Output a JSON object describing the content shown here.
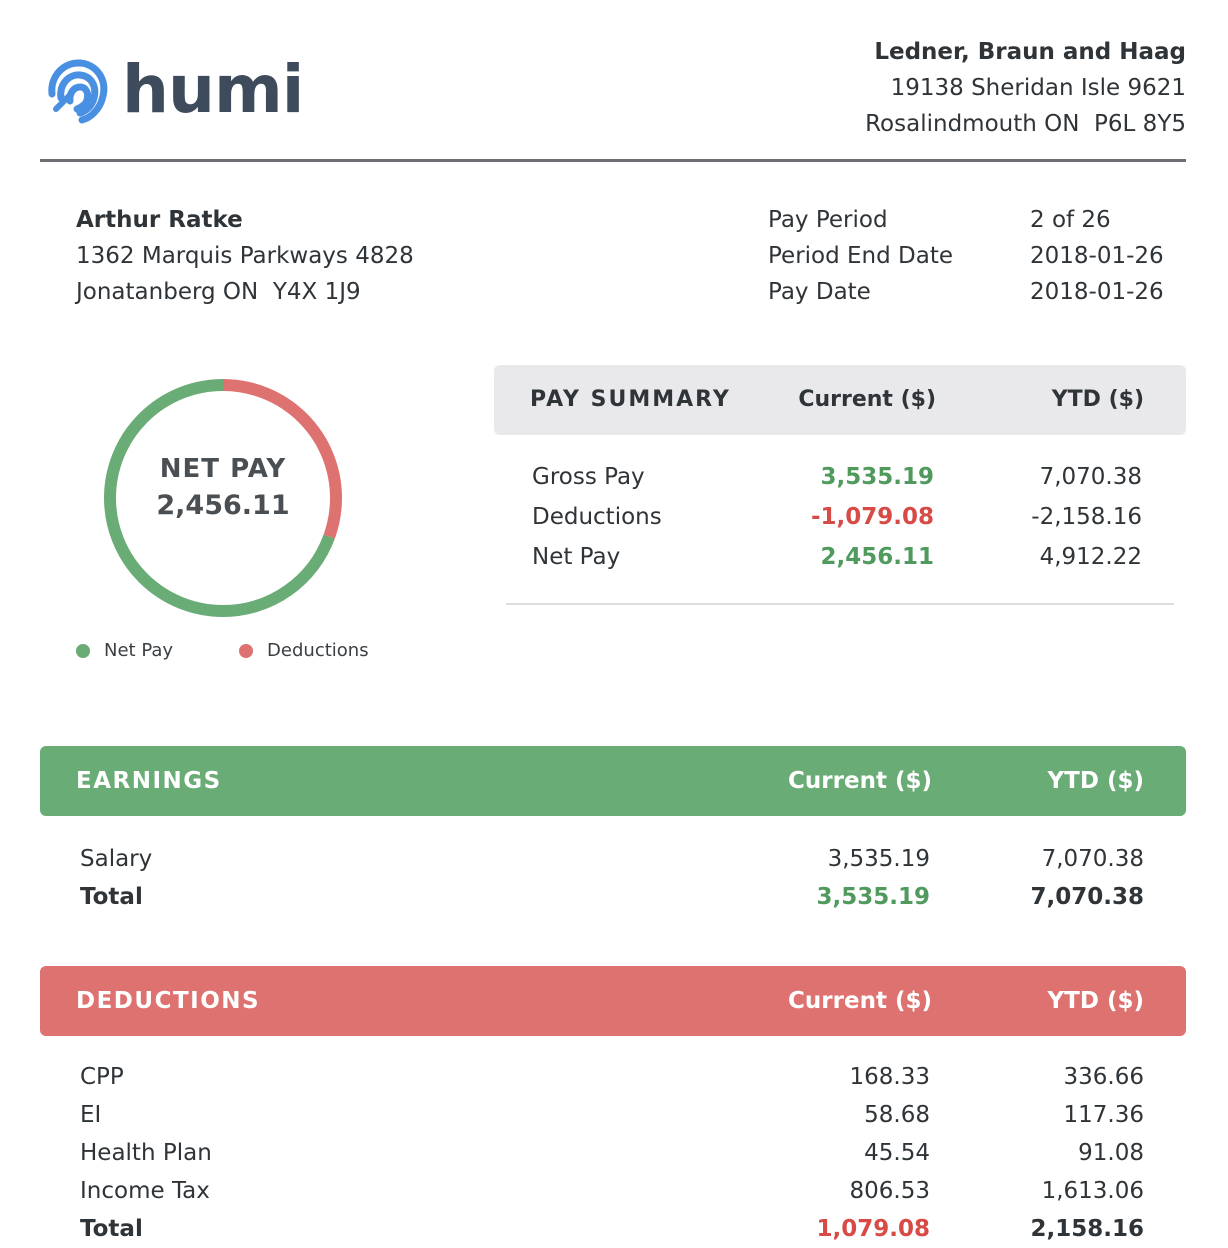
{
  "brand": {
    "name": "humi",
    "color": "#4a90e2"
  },
  "company": {
    "name": "Ledner, Braun and Haag",
    "address1": "19138 Sheridan Isle 9621",
    "address2": "Rosalindmouth ON  P6L 8Y5"
  },
  "employee": {
    "name": "Arthur Ratke",
    "address1": "1362 Marquis Parkways 4828",
    "address2": "Jonatanberg ON  Y4X 1J9"
  },
  "period": {
    "labels": [
      "Pay Period",
      "Period End Date",
      "Pay Date"
    ],
    "values": [
      "2 of 26",
      "2018-01-26",
      "2018-01-26"
    ]
  },
  "donut": {
    "label": "NET PAY",
    "value": "2,456.11",
    "net_pay_amount": 2456.11,
    "deductions_amount": 1079.08,
    "colors": {
      "net_pay": "#6aac76",
      "deductions": "#de7270"
    },
    "legend": [
      "Net Pay",
      "Deductions"
    ]
  },
  "summary": {
    "headers": [
      "PAY SUMMARY",
      "Current ($)",
      "YTD ($)"
    ],
    "rows": [
      {
        "label": "Gross Pay",
        "current": "3,535.19",
        "ytd": "7,070.38"
      },
      {
        "label": "Deductions",
        "current": "-1,079.08",
        "ytd": "-2,158.16"
      },
      {
        "label": "Net Pay",
        "current": "2,456.11",
        "ytd": "4,912.22"
      }
    ]
  },
  "earnings": {
    "headers": [
      "EARNINGS",
      "Current ($)",
      "YTD ($)"
    ],
    "rows": [
      {
        "label": "Salary",
        "current": "3,535.19",
        "ytd": "7,070.38"
      }
    ],
    "total": {
      "label": "Total",
      "current": "3,535.19",
      "ytd": "7,070.38"
    }
  },
  "deductions": {
    "headers": [
      "DEDUCTIONS",
      "Current ($)",
      "YTD ($)"
    ],
    "rows": [
      {
        "label": "CPP",
        "current": "168.33",
        "ytd": "336.66"
      },
      {
        "label": "EI",
        "current": "58.68",
        "ytd": "117.36"
      },
      {
        "label": "Health Plan",
        "current": "45.54",
        "ytd": "91.08"
      },
      {
        "label": "Income Tax",
        "current": "806.53",
        "ytd": "1,613.06"
      }
    ],
    "total": {
      "label": "Total",
      "current": "1,079.08",
      "ytd": "2,158.16"
    }
  },
  "colors": {
    "green": "#4f9a5c",
    "red": "#d84a45",
    "earnings_band": "#6aac76",
    "deductions_band": "#de7270"
  }
}
